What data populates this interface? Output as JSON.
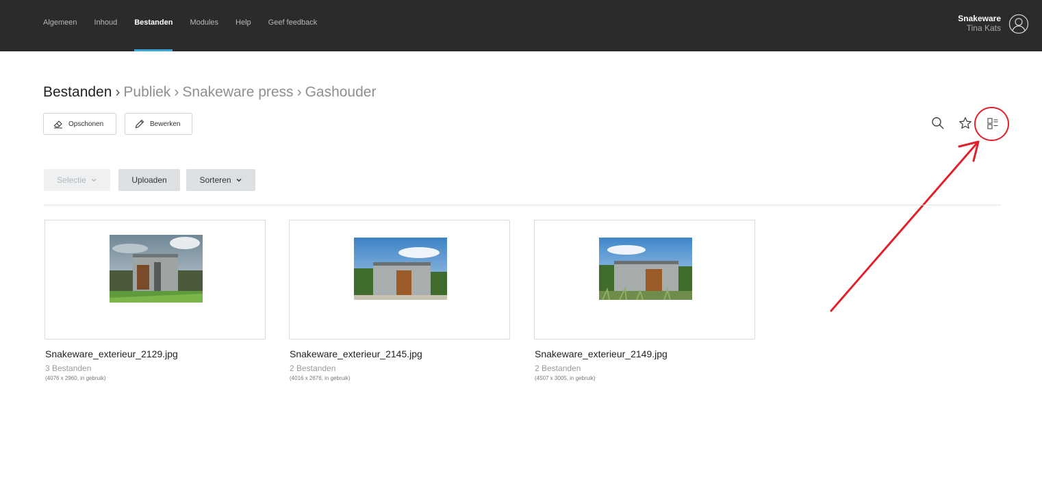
{
  "nav": {
    "items": [
      {
        "label": "Algemeen"
      },
      {
        "label": "Inhoud"
      },
      {
        "label": "Bestanden"
      },
      {
        "label": "Modules"
      },
      {
        "label": "Help"
      },
      {
        "label": "Geef feedback"
      }
    ],
    "active": "Bestanden"
  },
  "user": {
    "company": "Snakeware",
    "name": "Tina Kats",
    "icon": "user-circle-icon"
  },
  "breadcrumb": {
    "root": "Bestanden",
    "items": [
      "Publiek",
      "Snakeware press",
      "Gashouder"
    ],
    "separator": "›"
  },
  "toolbar": {
    "clean_label": "Opschonen",
    "edit_label": "Bewerken",
    "icons": [
      "search-icon",
      "star-icon",
      "view-toggle-icon"
    ]
  },
  "actions": {
    "select_label": "Selectie",
    "upload_label": "Uploaden",
    "sort_label": "Sorteren"
  },
  "files": [
    {
      "name": "Snakeware_exterieur_2129.jpg",
      "count": "3 Bestanden",
      "meta": "(4076 x 2960, in gebruik)"
    },
    {
      "name": "Snakeware_exterieur_2145.jpg",
      "count": "2 Bestanden",
      "meta": "(4016 x 2676, in gebruik)"
    },
    {
      "name": "Snakeware_exterieur_2149.jpg",
      "count": "2 Bestanden",
      "meta": "(4507 x 3005, in gebruik)"
    }
  ],
  "colors": {
    "topbar": "#2b2b2b",
    "nav_active_underline": "#3aa6d9",
    "annotation": "#e0212a"
  }
}
